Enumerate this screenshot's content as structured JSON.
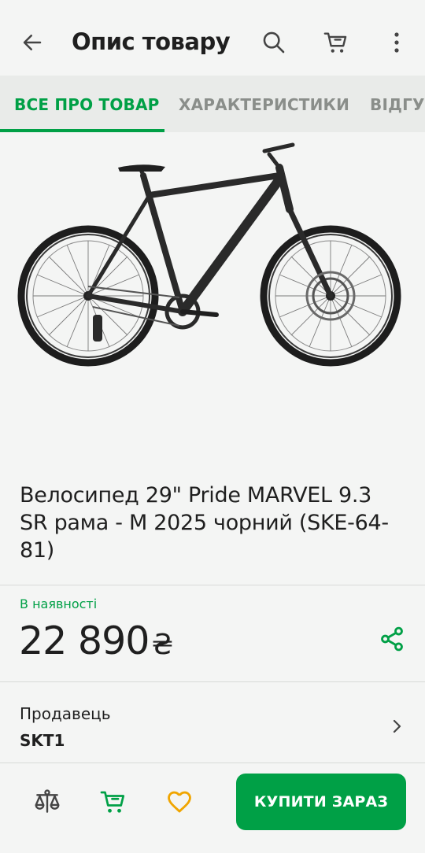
{
  "header": {
    "title": "Опис товару",
    "back_icon": "arrow-left-icon",
    "search_icon": "search-icon",
    "cart_icon": "cart-icon",
    "more_icon": "more-vertical-icon"
  },
  "tabs": [
    {
      "label": "ВСЕ ПРО ТОВАР",
      "active": true
    },
    {
      "label": "ХАРАКТЕРИСТИКИ",
      "active": false
    },
    {
      "label": "ВІДГУКИ",
      "active": false
    }
  ],
  "product": {
    "title": "Велосипед 29\" Pride MARVEL 9.3 SR рама - M 2025 чорний (SKE-64-81)",
    "availability": "В наявності",
    "price": "22 890",
    "currency": "₴"
  },
  "seller": {
    "label": "Продавець",
    "name": "SKT1"
  },
  "bottom_bar": {
    "buy_label": "КУПИТИ ЗАРАЗ",
    "compare_icon": "compare-scales-icon",
    "cart_icon": "cart-icon",
    "favorite_icon": "heart-icon"
  },
  "colors": {
    "accent": "#00a046",
    "favorite": "#f0a500",
    "background": "#f4f5f4",
    "tabs_bg": "#e9ebe9"
  }
}
